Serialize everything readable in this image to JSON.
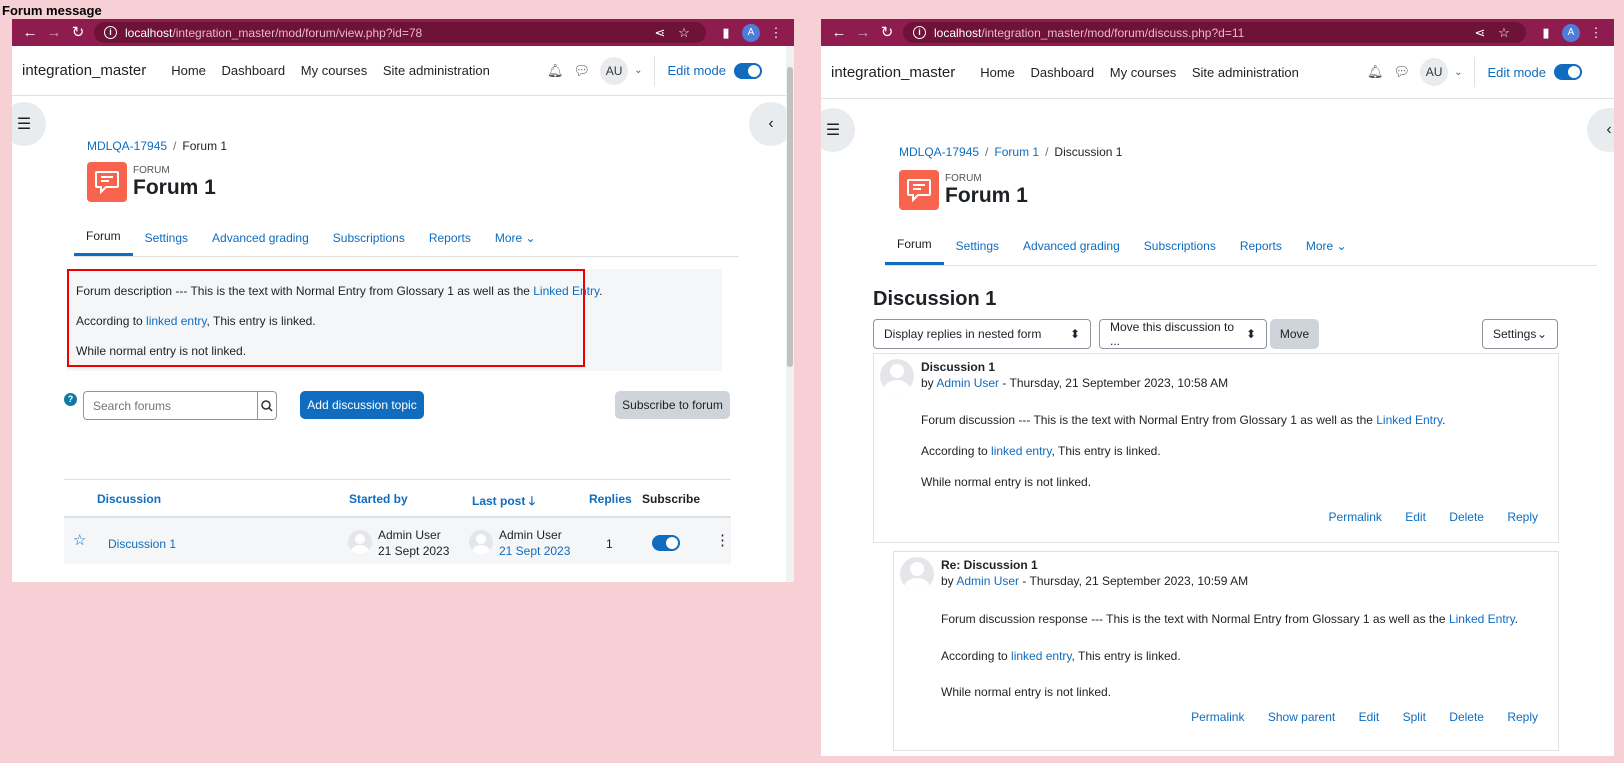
{
  "caption": "Forum message",
  "window1": {
    "url_host": "localhost",
    "url_path": "/integration_master/mod/forum/view.php?id=78",
    "site_name": "integration_master",
    "menu": [
      "Home",
      "Dashboard",
      "My courses",
      "Site administration"
    ],
    "avatar_initials": "AU",
    "edit_mode": "Edit mode",
    "breadcrumb": [
      "MDLQA-17945",
      "Forum 1"
    ],
    "module_type": "FORUM",
    "module_title": "Forum 1",
    "tabs": [
      "Forum",
      "Settings",
      "Advanced grading",
      "Subscriptions",
      "Reports",
      "More ⌄"
    ],
    "description": {
      "line1_pre": "Forum description --- This is the text with Normal Entry from Glossary 1 as well as the ",
      "line1_link": "Linked Entry",
      "line1_post": ".",
      "line2_pre": "According to ",
      "line2_link": "linked entry",
      "line2_post": ", This entry is linked.",
      "line3": "While normal entry is not linked."
    },
    "search_placeholder": "Search forums",
    "add_topic": "Add discussion topic",
    "subscribe_forum": "Subscribe to forum",
    "table_headers": {
      "discussion": "Discussion",
      "started_by": "Started by",
      "last_post": "Last post",
      "replies": "Replies",
      "subscribe": "Subscribe"
    },
    "row": {
      "title": "Discussion 1",
      "started_name": "Admin User",
      "started_date": "21 Sept 2023",
      "last_name": "Admin User",
      "last_date": "21 Sept 2023",
      "replies": "1"
    }
  },
  "window2": {
    "url_host": "localhost",
    "url_path": "/integration_master/mod/forum/discuss.php?d=11",
    "site_name": "integration_master",
    "menu": [
      "Home",
      "Dashboard",
      "My courses",
      "Site administration"
    ],
    "avatar_initials": "AU",
    "edit_mode": "Edit mode",
    "breadcrumb": [
      "MDLQA-17945",
      "Forum 1",
      "Discussion 1"
    ],
    "module_type": "FORUM",
    "module_title": "Forum 1",
    "tabs": [
      "Forum",
      "Settings",
      "Advanced grading",
      "Subscriptions",
      "Reports",
      "More ⌄"
    ],
    "discussion_title": "Discussion 1",
    "display_select": "Display replies in nested form",
    "move_select": "Move this discussion to ...",
    "move_btn": "Move",
    "settings_btn": "Settings",
    "post1": {
      "subject": "Discussion 1",
      "by": "by ",
      "author": "Admin User",
      "date": " - Thursday, 21 September 2023, 10:58 AM",
      "line1_pre": "Forum discussion --- This is the text with Normal Entry from Glossary 1 as well as the ",
      "line1_link": "Linked Entry",
      "line1_post": ".",
      "line2_pre": "According to ",
      "line2_link": "linked entry",
      "line2_post": ", This entry is linked.",
      "line3": "While normal entry is not linked.",
      "actions": [
        "Permalink",
        "Edit",
        "Delete",
        "Reply"
      ]
    },
    "post2": {
      "subject": "Re: Discussion 1",
      "by": "by ",
      "author": "Admin User",
      "date": " - Thursday, 21 September 2023, 10:59 AM",
      "line1_pre": "Forum discussion response --- This is the text with Normal Entry from Glossary 1 as well as the ",
      "line1_link": "Linked Entry",
      "line1_post": ".",
      "line2_pre": "According to ",
      "line2_link": "linked entry",
      "line2_post": ", This entry is linked.",
      "line3": "While normal entry is not linked.",
      "actions": [
        "Permalink",
        "Show parent",
        "Edit",
        "Split",
        "Delete",
        "Reply"
      ]
    }
  }
}
